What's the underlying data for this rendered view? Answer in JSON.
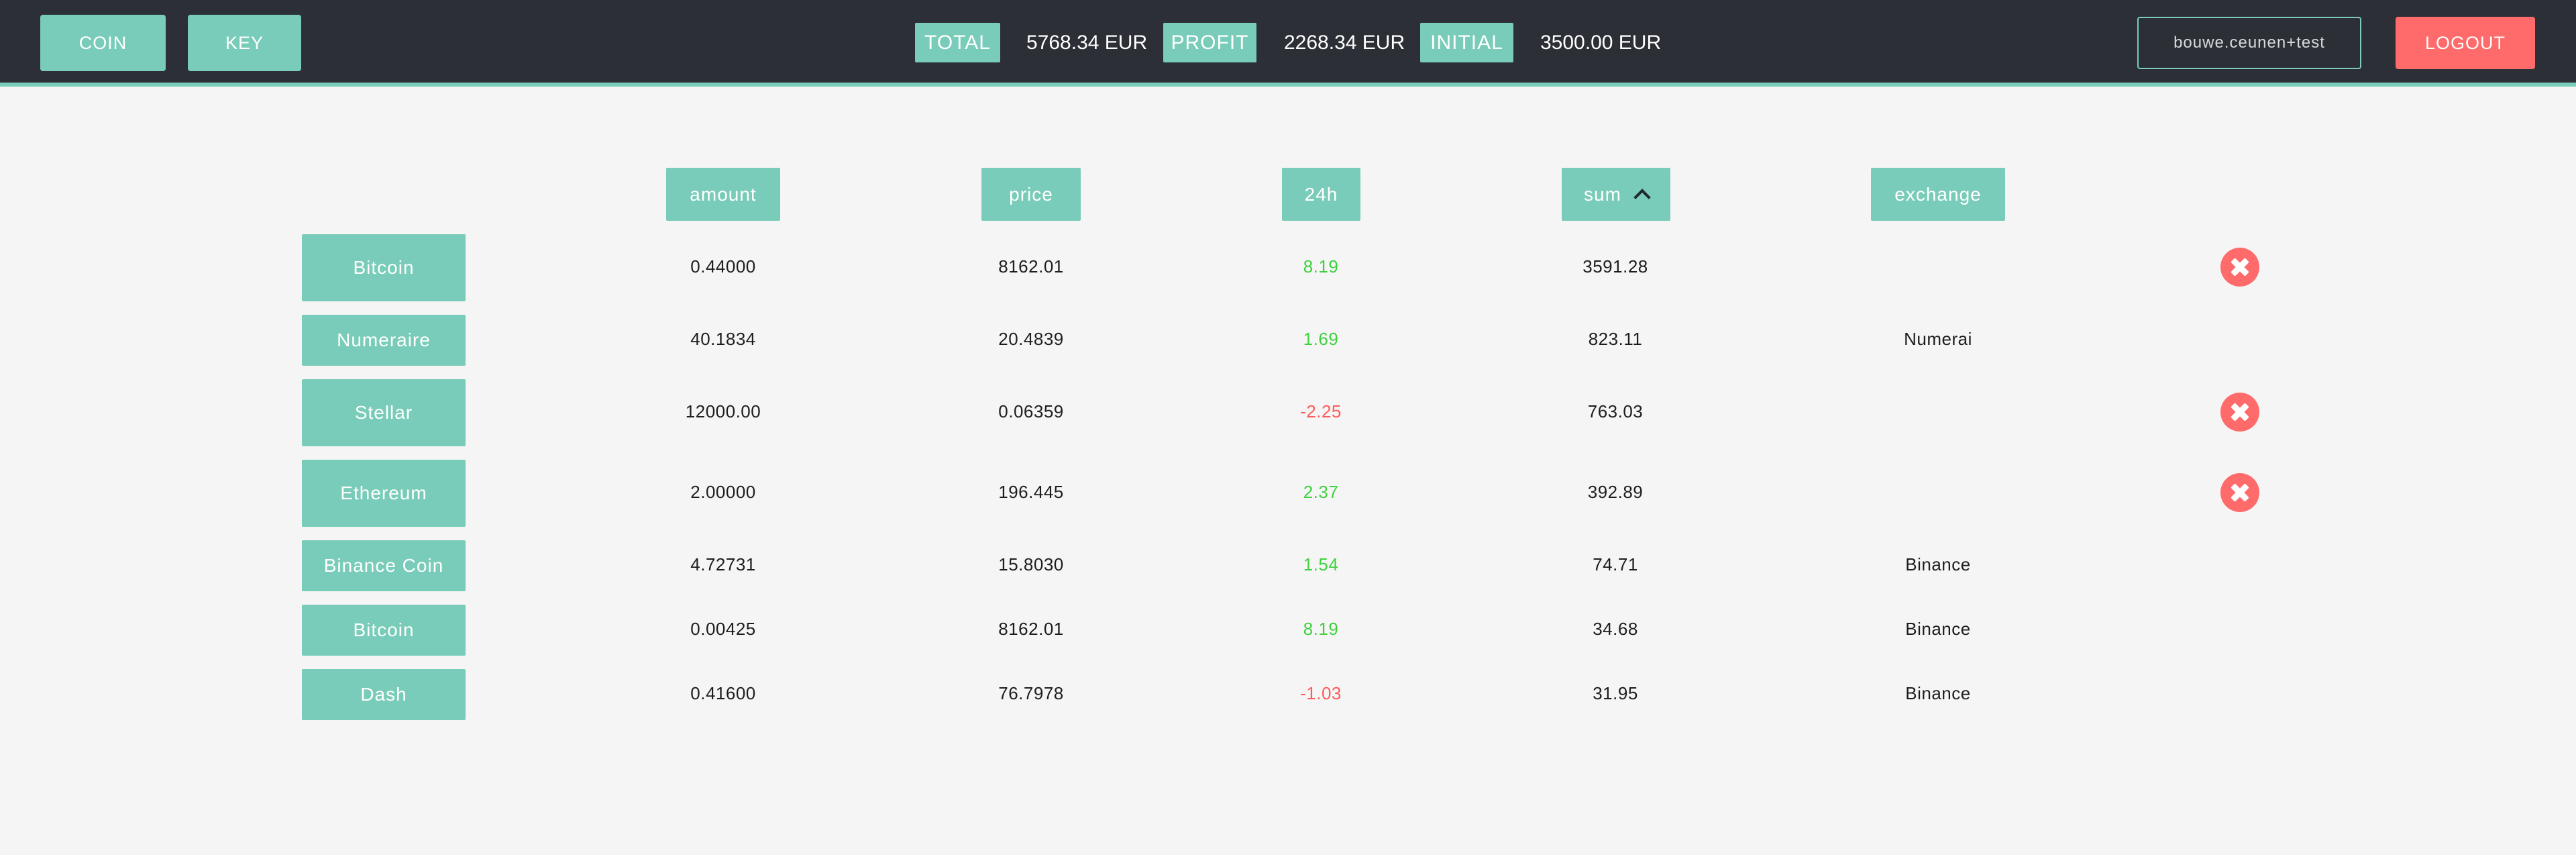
{
  "header": {
    "coin_label": "COIN",
    "key_label": "KEY",
    "total_label": "TOTAL",
    "total_value": "5768.34 EUR",
    "profit_label": "PROFIT",
    "profit_value": "2268.34 EUR",
    "initial_label": "INITIAL",
    "initial_value": "3500.00 EUR",
    "user": "bouwe.ceunen+test",
    "logout_label": "LOGOUT"
  },
  "columns": {
    "amount": "amount",
    "price": "price",
    "change": "24h",
    "sum": "sum",
    "exchange": "exchange"
  },
  "sort": {
    "column": "sum",
    "icon": "chevron-up-icon"
  },
  "colors": {
    "accent": "#79ccb9",
    "header_bg": "#2c3036",
    "danger": "#ff6b6b",
    "positive": "#3ed13e",
    "negative": "#ff5a5a"
  },
  "rows": [
    {
      "coin": "Bitcoin",
      "amount": "0.44000",
      "price": "8162.01",
      "change": "8.19",
      "sum": "3591.28",
      "exchange": "",
      "deletable": true
    },
    {
      "coin": "Numeraire",
      "amount": "40.1834",
      "price": "20.4839",
      "change": "1.69",
      "sum": "823.11",
      "exchange": "Numerai",
      "deletable": false
    },
    {
      "coin": "Stellar",
      "amount": "12000.00",
      "price": "0.06359",
      "change": "-2.25",
      "sum": "763.03",
      "exchange": "",
      "deletable": true
    },
    {
      "coin": "Ethereum",
      "amount": "2.00000",
      "price": "196.445",
      "change": "2.37",
      "sum": "392.89",
      "exchange": "",
      "deletable": true
    },
    {
      "coin": "Binance Coin",
      "amount": "4.72731",
      "price": "15.8030",
      "change": "1.54",
      "sum": "74.71",
      "exchange": "Binance",
      "deletable": false
    },
    {
      "coin": "Bitcoin",
      "amount": "0.00425",
      "price": "8162.01",
      "change": "8.19",
      "sum": "34.68",
      "exchange": "Binance",
      "deletable": false
    },
    {
      "coin": "Dash",
      "amount": "0.41600",
      "price": "76.7978",
      "change": "-1.03",
      "sum": "31.95",
      "exchange": "Binance",
      "deletable": false
    }
  ]
}
